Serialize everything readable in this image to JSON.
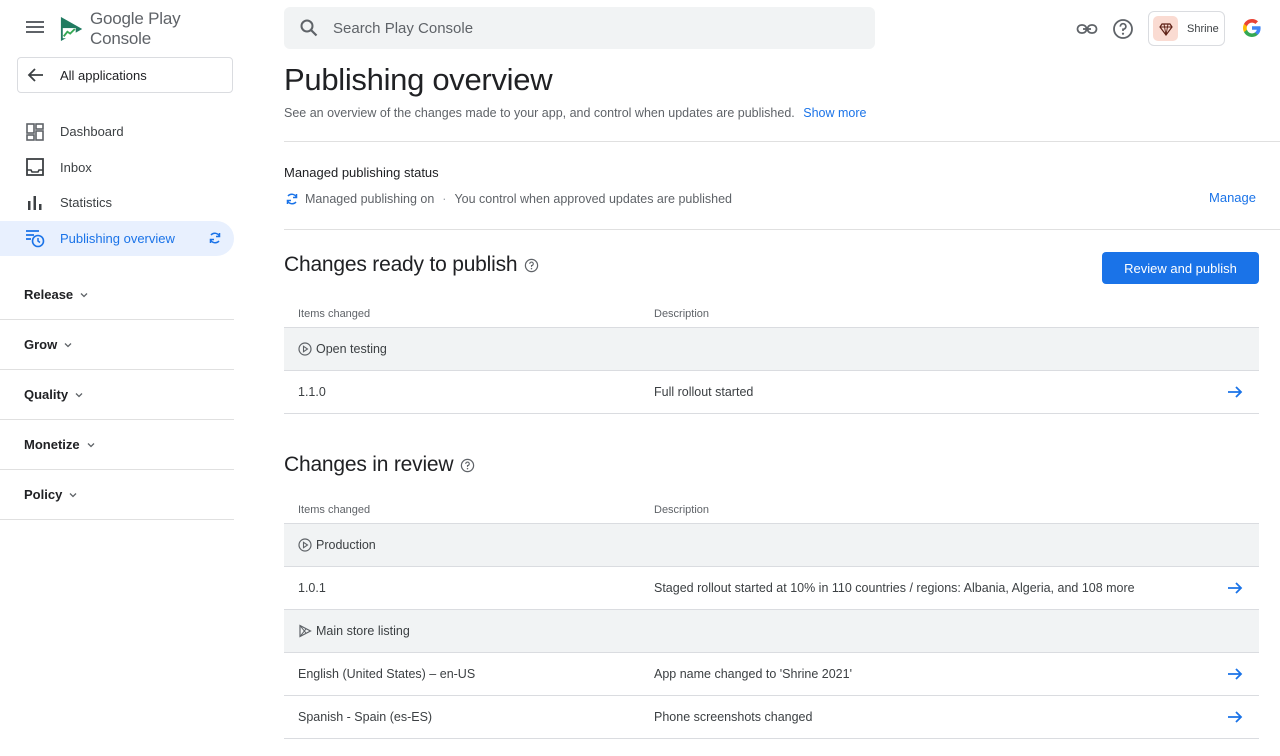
{
  "header": {
    "brand_name": "Google Play Console",
    "search_placeholder": "Search Play Console",
    "app_name": "Shrine"
  },
  "sidebar": {
    "back_label": "All applications",
    "items": [
      {
        "label": "Dashboard",
        "icon": "dashboard-icon"
      },
      {
        "label": "Inbox",
        "icon": "inbox-icon"
      },
      {
        "label": "Statistics",
        "icon": "bar-chart-icon"
      },
      {
        "label": "Publishing overview",
        "icon": "publishing-icon",
        "active": true,
        "trailing_icon": "sync-icon"
      }
    ],
    "sections": [
      {
        "label": "Release"
      },
      {
        "label": "Grow"
      },
      {
        "label": "Quality"
      },
      {
        "label": "Monetize"
      },
      {
        "label": "Policy"
      }
    ]
  },
  "main": {
    "title": "Publishing overview",
    "subtitle": "See an overview of the changes made to your app, and control when updates are published.",
    "show_more": "Show more",
    "managed_publishing": {
      "title": "Managed publishing status",
      "status": "Managed publishing on",
      "separator": "·",
      "detail": "You control when approved updates are published",
      "manage_label": "Manage"
    },
    "ready": {
      "title": "Changes ready to publish",
      "button_label": "Review and publish",
      "columns": [
        "Items changed",
        "Description"
      ],
      "groups": [
        {
          "label": "Open testing",
          "icon": "play-circle-icon",
          "rows": [
            {
              "item": "1.1.0",
              "description": "Full rollout started"
            }
          ]
        }
      ]
    },
    "review": {
      "title": "Changes in review",
      "columns": [
        "Items changed",
        "Description"
      ],
      "groups": [
        {
          "label": "Production",
          "icon": "play-circle-icon",
          "rows": [
            {
              "item": "1.0.1",
              "description": "Staged rollout started at 10% in 110 countries / regions: Albania, Algeria, and 108 more"
            }
          ]
        },
        {
          "label": "Main store listing",
          "icon": "play-store-icon",
          "rows": [
            {
              "item": "English (United States) – en-US",
              "description": "App name changed to 'Shrine 2021'"
            },
            {
              "item": "Spanish - Spain (es-ES)",
              "description": "Phone screenshots changed"
            }
          ]
        }
      ]
    }
  },
  "colors": {
    "accent": "#1a73e8",
    "active_bg": "#e8f0fe",
    "group_bg": "#f1f3f4",
    "chip_bg": "#fadbd2"
  }
}
